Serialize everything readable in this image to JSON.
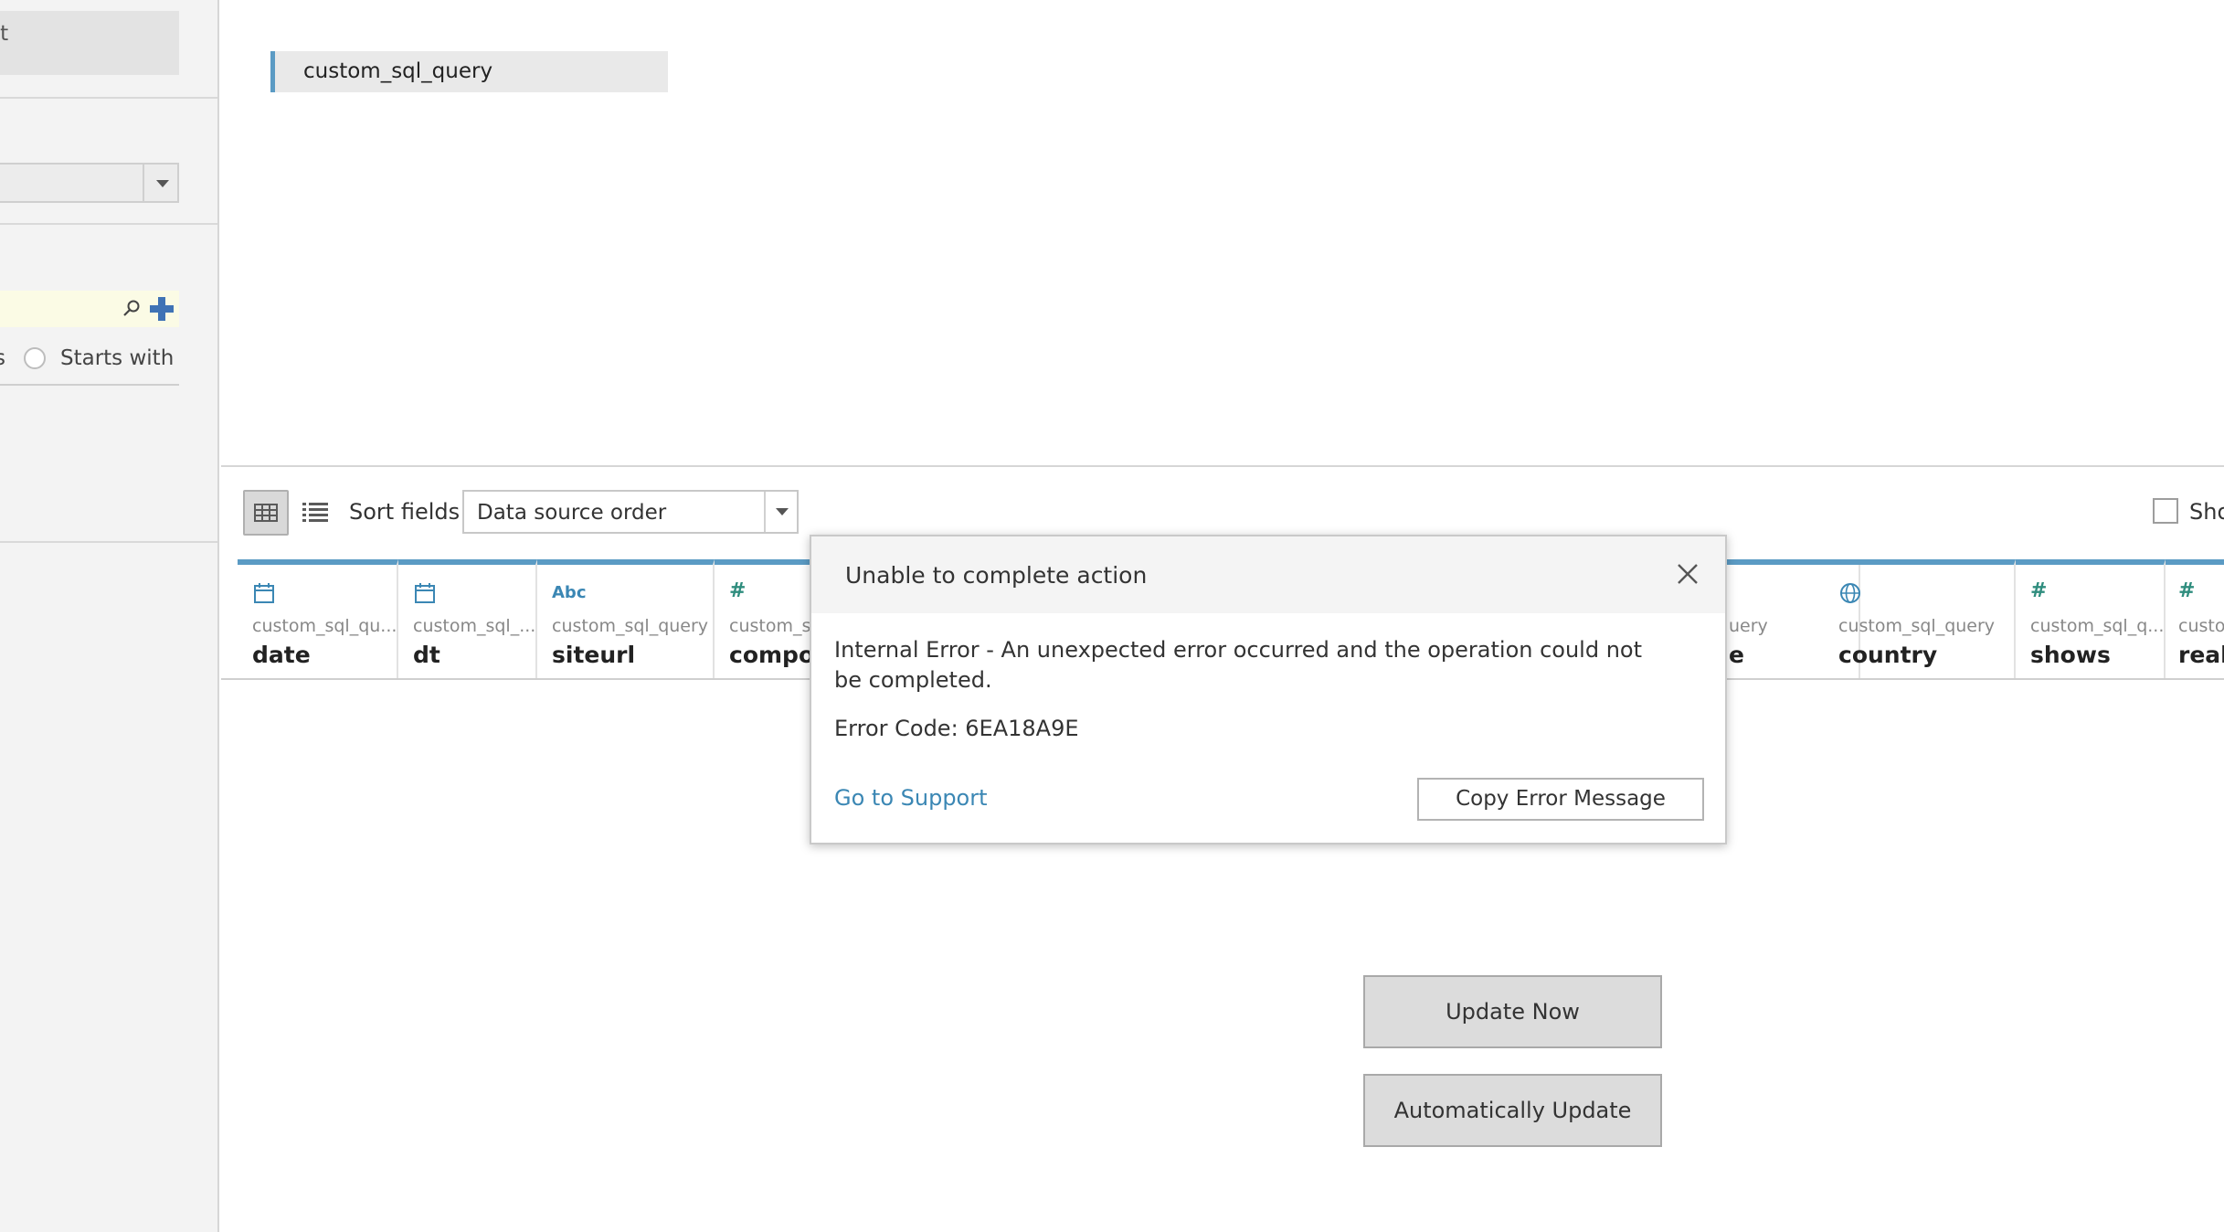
{
  "sidebar": {
    "connection_text": "et",
    "search_options": {
      "partial_label": "s",
      "starts_with_label": "Starts with"
    }
  },
  "canvas": {
    "table_name": "custom_sql_query"
  },
  "toolbar": {
    "sort_label": "Sort fields",
    "sort_value": "Data source order",
    "show_label": "Sho"
  },
  "fields": [
    {
      "icon": "calendar-icon",
      "source": "custom_sql_qu...",
      "name": "date"
    },
    {
      "icon": "calendar-icon",
      "source": "custom_sql_...",
      "name": "dt"
    },
    {
      "icon": "abc-icon",
      "icon_text": "Abc",
      "source": "custom_sql_query",
      "name": "siteurl"
    },
    {
      "icon": "number-icon",
      "icon_text": "#",
      "source": "custom_sq",
      "name": "compos"
    },
    {
      "icon": "",
      "source": "uery",
      "name": "e"
    },
    {
      "icon": "globe-icon",
      "source": "custom_sql_query",
      "name": "country"
    },
    {
      "icon": "number-icon",
      "icon_text": "#",
      "source": "custom_sql_q...",
      "name": "shows"
    },
    {
      "icon": "number-icon",
      "icon_text": "#",
      "source": "custo",
      "name": "real"
    }
  ],
  "buttons": {
    "update_now": "Update Now",
    "auto_update": "Automatically Update"
  },
  "dialog": {
    "title": "Unable to complete action",
    "message": "Internal Error - An unexpected error occurred and the operation could not be completed.",
    "error_code": "Error Code: 6EA18A9E",
    "support_link": "Go to Support",
    "copy_button": "Copy Error Message"
  },
  "colors": {
    "accent": "#5b9bc4",
    "link": "#3b87b4",
    "icon": "#2f8d7e"
  }
}
